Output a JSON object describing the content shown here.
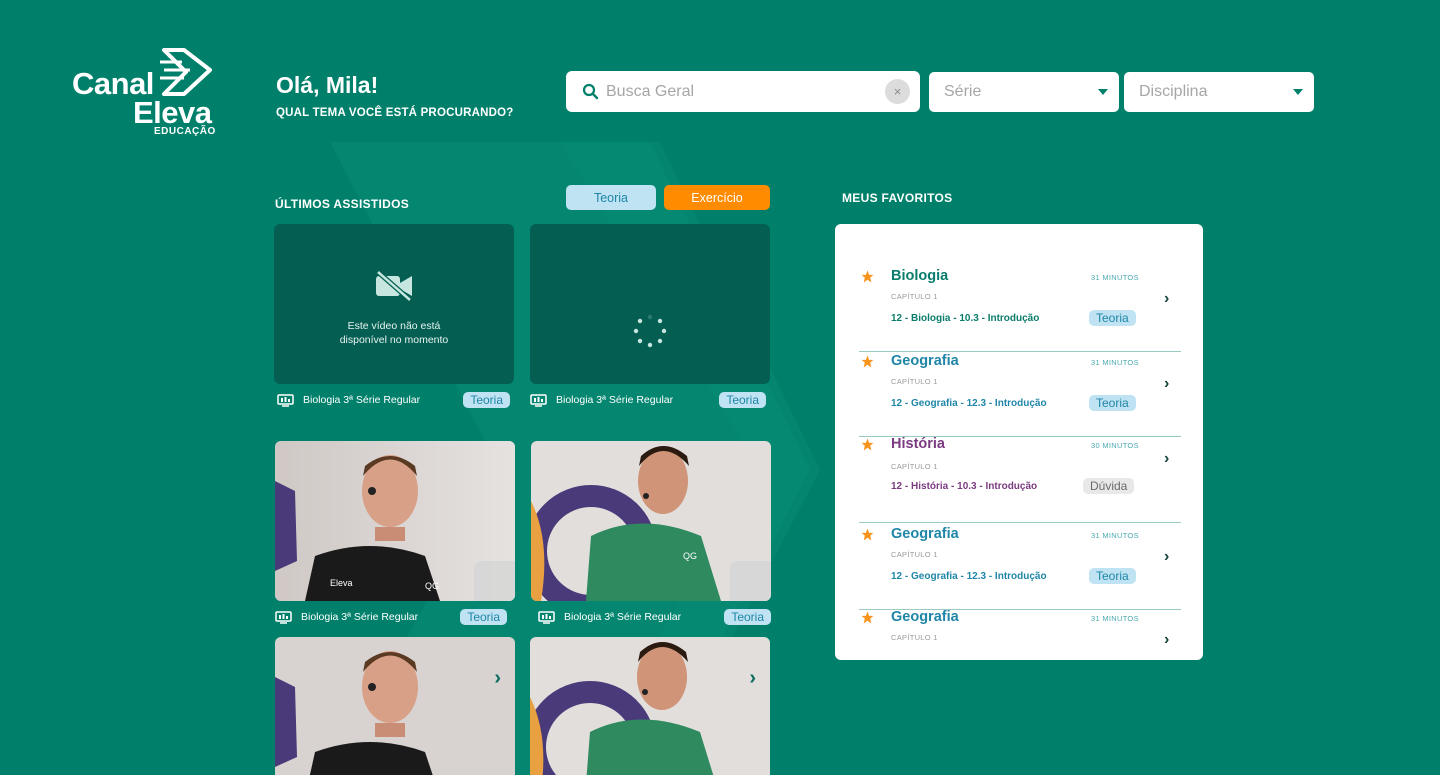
{
  "brand": {
    "line1": "Canal",
    "line2": "Eleva",
    "line3": "EDUCAÇÃO"
  },
  "greeting": {
    "title": "Olá, Mila!",
    "subtitle": "QUAL TEMA VOCÊ ESTÁ PROCURANDO?"
  },
  "search": {
    "placeholder": "Busca Geral",
    "value": "",
    "clear_label": "×"
  },
  "filters": {
    "serie": "Série",
    "disciplina": "Disciplina"
  },
  "recent": {
    "title": "ÚLTIMOS ASSISTIDOS",
    "tabs": [
      "Teoria",
      "Exercício"
    ],
    "unavailable_text_1": "Este vídeo não está",
    "unavailable_text_2": "disponível no momento",
    "videos": [
      {
        "title": "Biologia 3ª Série Regular",
        "badge": "Teoria",
        "state": "unavailable"
      },
      {
        "title": "Biologia 3ª Série Regular",
        "badge": "Teoria",
        "state": "loading"
      },
      {
        "title": "Biologia 3ª Série Regular",
        "badge": "Teoria",
        "state": "teacher-1"
      },
      {
        "title": "Biologia 3ª Série Regular",
        "badge": "Teoria",
        "state": "teacher-2"
      },
      {
        "title": "",
        "badge": "",
        "state": "teacher-1"
      },
      {
        "title": "",
        "badge": "",
        "state": "teacher-2"
      }
    ]
  },
  "favorites": {
    "title": "MEUS FAVORITOS",
    "items": [
      {
        "subject": "Biologia",
        "minutes": "31 MINUTOS",
        "chapter": "CAPÍTULO 1",
        "lesson": "12 - Biologia - 10.3 - Introdução",
        "tag": "Teoria",
        "color": "#0b7d6c"
      },
      {
        "subject": "Geografia",
        "minutes": "31 MINUTOS",
        "chapter": "CAPÍTULO 1",
        "lesson": "12 - Geografia - 12.3 - Introdução",
        "tag": "Teoria",
        "color": "#1f86a8"
      },
      {
        "subject": "História",
        "minutes": "30 MINUTOS",
        "chapter": "CAPÍTULO 1",
        "lesson": "12 - História - 10.3 - Introdução",
        "tag": "Dúvida",
        "color": "#7b3b80"
      },
      {
        "subject": "Geografia",
        "minutes": "31 MINUTOS",
        "chapter": "CAPÍTULO 1",
        "lesson": "12 - Geografia - 12.3 - Introdução",
        "tag": "Teoria",
        "color": "#1f86a8"
      },
      {
        "subject": "Geografia",
        "minutes": "31 MINUTOS",
        "chapter": "CAPÍTULO 1",
        "lesson": "",
        "tag": "",
        "color": "#1f86a8"
      }
    ]
  },
  "colors": {
    "background": "#00806b",
    "accent_orange": "#ff8c00",
    "card_dark": "#045f52",
    "star": "#f7941d"
  }
}
